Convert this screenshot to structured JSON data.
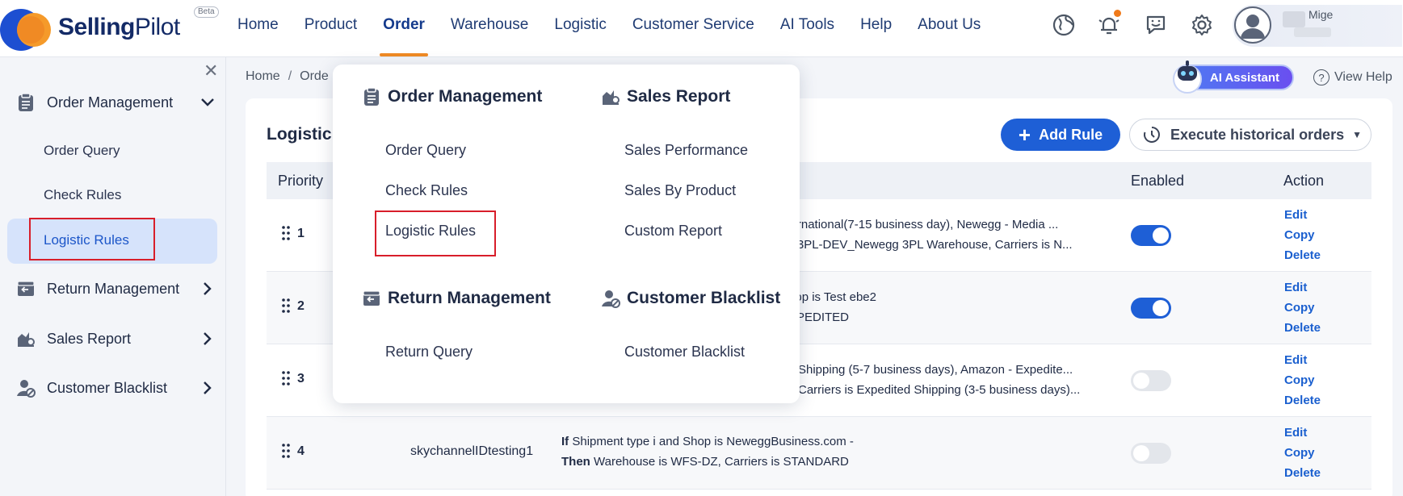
{
  "brand": {
    "name_bold": "Selling",
    "name_light": "Pilot",
    "badge": "Beta"
  },
  "nav": [
    "Home",
    "Product",
    "Order",
    "Warehouse",
    "Logistic",
    "Customer Service",
    "AI Tools",
    "Help",
    "About Us"
  ],
  "user": {
    "name": "Mige"
  },
  "sidebar": {
    "groups": [
      {
        "label": "Order Management",
        "icon": "clipboard-icon"
      },
      {
        "label": "Return Management",
        "icon": "return-box-icon"
      },
      {
        "label": "Sales Report",
        "icon": "chart-report-icon"
      },
      {
        "label": "Customer Blacklist",
        "icon": "user-block-icon"
      }
    ],
    "subitems": [
      "Order Query",
      "Check Rules",
      "Logistic Rules"
    ]
  },
  "breadcrumb": [
    "Home",
    "Orde"
  ],
  "ai_assistant": "AI Assistant",
  "view_help": "View Help",
  "card": {
    "title": "Logistic",
    "add_rule": "Add Rule",
    "execute": "Execute historical orders"
  },
  "table": {
    "headers": {
      "priority": "Priority",
      "enabled": "Enabled",
      "action": "Action"
    },
    "actions": {
      "edit": "Edit",
      "copy": "Copy",
      "delete": "Delete"
    },
    "rows": [
      {
        "priority": "1",
        "name": "",
        "line1": "nternational(7-15 business day), Newegg - Media ...",
        "line2": "gg 3PL-DEV_Newegg 3PL Warehouse, Carriers is N...",
        "enabled": true
      },
      {
        "priority": "2",
        "name": "",
        "line1": "Shop is Test ebe2",
        "line2": "EXPEDITED",
        "enabled": true
      },
      {
        "priority": "3",
        "name": "",
        "line1": "Shipping (5-7 business days), Amazon - Expedite...",
        "line2": "Carriers is Expedited Shipping (3-5 business days)...",
        "enabled": false
      },
      {
        "priority": "4",
        "name": "skychannelIDtesting1",
        "if_kw": "If",
        "line1": "Shipment type i and Shop is NeweggBusiness.com -",
        "then_kw": "Then",
        "line2": "Warehouse is WFS-DZ, Carriers is STANDARD",
        "enabled": false
      }
    ]
  },
  "mega_menu": {
    "col1": [
      {
        "heading": "Order Management",
        "icon": "clipboard-icon",
        "items": [
          "Order Query",
          "Check Rules",
          "Logistic Rules"
        ]
      },
      {
        "heading": "Return Management",
        "icon": "return-box-icon",
        "items": [
          "Return Query"
        ]
      }
    ],
    "col2": [
      {
        "heading": "Sales Report",
        "icon": "chart-report-icon",
        "items": [
          "Sales Performance",
          "Sales By Product",
          "Custom Report"
        ]
      },
      {
        "heading": "Customer Blacklist",
        "icon": "user-block-icon",
        "items": [
          "Customer Blacklist"
        ]
      }
    ]
  },
  "colors": {
    "primary": "#1e5fd6",
    "accent": "#f08a24",
    "highlight": "#d81e2a"
  }
}
